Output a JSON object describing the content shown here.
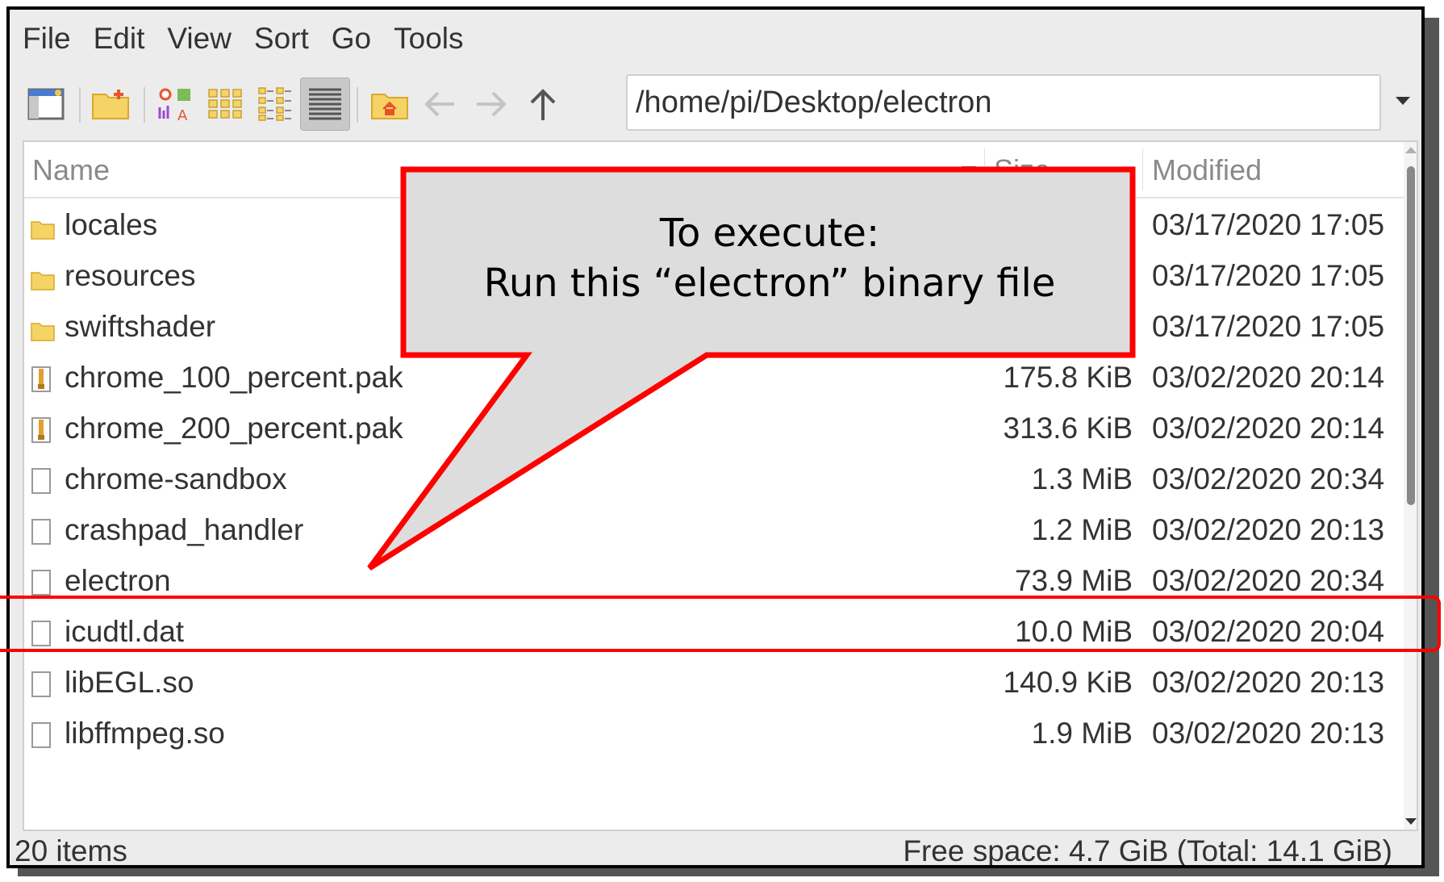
{
  "menubar": {
    "items": [
      "File",
      "Edit",
      "View",
      "Sort",
      "Go",
      "Tools"
    ]
  },
  "toolbar": {
    "path": "/home/pi/Desktop/electron",
    "buttons": [
      "new-window-icon",
      "new-folder-icon",
      "icon-view-icon",
      "thumbnail-view-icon",
      "compact-view-icon",
      "detailed-list-view-icon",
      "home-icon",
      "back-arrow-icon",
      "forward-arrow-icon",
      "up-arrow-icon"
    ]
  },
  "list": {
    "columns": {
      "name": "Name",
      "size": "Size",
      "modified": "Modified"
    },
    "rows": [
      {
        "name": "locales",
        "size": "",
        "modified": "03/17/2020 17:05",
        "type": "folder"
      },
      {
        "name": "resources",
        "size": "",
        "modified": "03/17/2020 17:05",
        "type": "folder"
      },
      {
        "name": "swiftshader",
        "size": "",
        "modified": "03/17/2020 17:05",
        "type": "folder"
      },
      {
        "name": "chrome_100_percent.pak",
        "size": "175.8 KiB",
        "modified": "03/02/2020 20:14",
        "type": "archive"
      },
      {
        "name": "chrome_200_percent.pak",
        "size": "313.6 KiB",
        "modified": "03/02/2020 20:14",
        "type": "archive"
      },
      {
        "name": "chrome-sandbox",
        "size": "1.3 MiB",
        "modified": "03/02/2020 20:34",
        "type": "file"
      },
      {
        "name": "crashpad_handler",
        "size": "1.2 MiB",
        "modified": "03/02/2020 20:13",
        "type": "file"
      },
      {
        "name": "electron",
        "size": "73.9 MiB",
        "modified": "03/02/2020 20:34",
        "type": "file"
      },
      {
        "name": "icudtl.dat",
        "size": "10.0 MiB",
        "modified": "03/02/2020 20:04",
        "type": "file"
      },
      {
        "name": "libEGL.so",
        "size": "140.9 KiB",
        "modified": "03/02/2020 20:13",
        "type": "file"
      },
      {
        "name": "libffmpeg.so",
        "size": "1.9 MiB",
        "modified": "03/02/2020 20:13",
        "type": "file"
      }
    ]
  },
  "status": {
    "items": "20 items",
    "free": "Free space: 4.7 GiB (Total: 14.1 GiB)"
  },
  "callout": {
    "line1": "To execute:",
    "line2": "Run this “electron” binary file"
  },
  "colors": {
    "annotation": "#ff0000",
    "callout_fill": "#dddddd",
    "folder": "#f6d365"
  }
}
